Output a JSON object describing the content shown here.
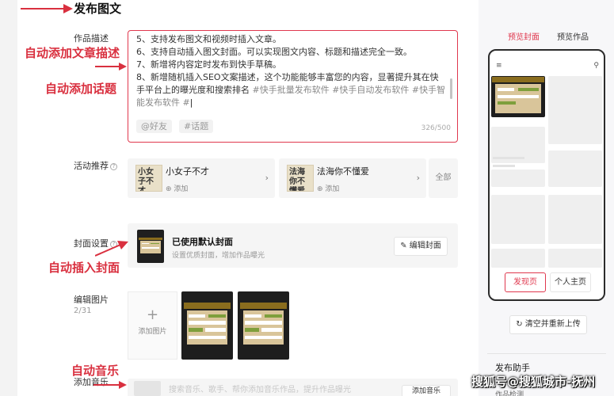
{
  "page": {
    "title": "发布图文"
  },
  "description": {
    "label": "作品描述",
    "lines": [
      "5、支持发布图文和视频时插入文章。",
      "6、支持自动插入图文封面。可以实现图文内容、标题和描述完全一致。",
      "7、新增将内容定时发布到快手草稿。",
      "8、新增随机插入SEO文案描述，这个功能能够丰富您的内容，显著提升其在快手平台上的曝光度和搜索排名",
      "#快手批量发布软件 #快手自动发布软件 #快手智能发布软件 #"
    ],
    "mention_chip": "@好友",
    "topic_chip": "#话题",
    "counter": "326/500"
  },
  "annotations": {
    "auto_description": "自动添加文章描述",
    "auto_topic": "自动添加话题",
    "auto_cover": "自动插入封面",
    "auto_music": "自动音乐",
    "arrow_color": "#d9303f"
  },
  "activity": {
    "label": "活动推荐",
    "cards": [
      {
        "thumb_text": "小女子不才",
        "title": "小女子不才",
        "add_label": "添加"
      },
      {
        "thumb_text": "法海你不懂爱",
        "title": "法海你不懂爱",
        "add_label": "添加"
      }
    ],
    "all_label": "全部"
  },
  "cover": {
    "label": "封面设置",
    "title": "已使用默认封面",
    "subtitle": "设置优质封面，增加作品曝光",
    "edit_button": "编辑封面"
  },
  "images": {
    "label": "编辑图片",
    "count": "2/31",
    "add_label": "添加图片"
  },
  "music": {
    "label": "添加音乐",
    "hint": "搜索音乐、歌手、帮你添加音乐作品，提升作品曝光",
    "add_button": "添加音乐"
  },
  "preview": {
    "tabs": [
      "预览封面",
      "预览作品"
    ],
    "active_tab": 0,
    "phone_menu_icon": "menu-icon",
    "phone_search_icon": "search-icon",
    "footer_tabs": [
      "发现页",
      "个人主页"
    ],
    "reupload_button": "清空并重新上传",
    "helper_title": "发布助手",
    "helper_sub": "作品检测"
  },
  "watermark": "搜狐号@搜狐城市-抚州",
  "colors": {
    "accent": "#e0384e",
    "annotation": "#d9303f"
  }
}
